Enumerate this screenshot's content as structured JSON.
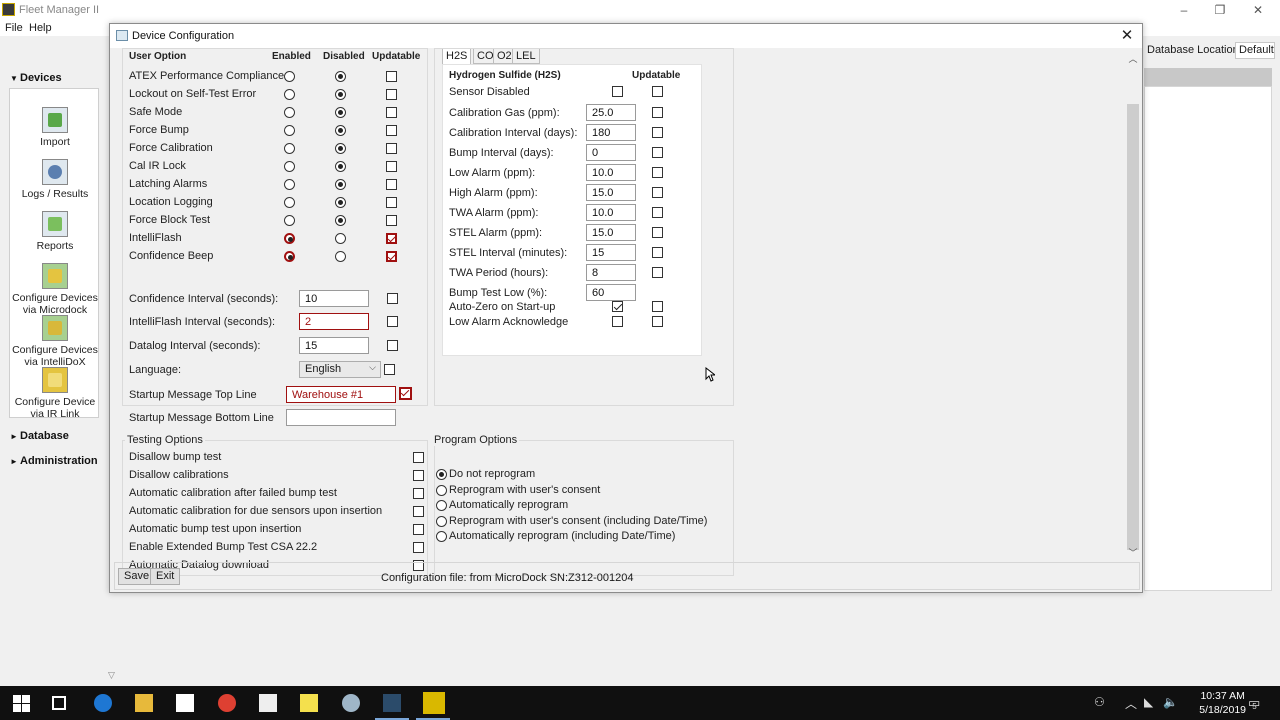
{
  "app": {
    "title": "Fleet Manager II",
    "menu": [
      "File",
      "Help"
    ],
    "sidebar": {
      "sections": [
        {
          "label": "Devices",
          "expanded": true
        },
        {
          "label": "Database",
          "expanded": false
        },
        {
          "label": "Administration",
          "expanded": false
        }
      ],
      "device_items": [
        {
          "label": "Import",
          "icon": "import-icon"
        },
        {
          "label": "Logs / Results",
          "icon": "logs-icon"
        },
        {
          "label": "Reports",
          "icon": "reports-icon"
        },
        {
          "label": "Configure Devices via Microdock",
          "icon": "microdock-icon"
        },
        {
          "label": "Configure Devices via IntelliDoX",
          "icon": "intellidox-icon"
        },
        {
          "label": "Configure Device via IR Link",
          "icon": "ir-link-icon"
        }
      ]
    },
    "database_location_label": "Database Location:",
    "database_location_value": "Default"
  },
  "dialog": {
    "title": "Device Configuration",
    "close": "✕",
    "user_options": {
      "headers": {
        "option": "User Option",
        "enabled": "Enabled",
        "disabled": "Disabled",
        "updatable": "Updatable"
      },
      "rows": [
        {
          "label": "ATEX Performance Compliance",
          "enabled": false,
          "updatable": false,
          "highlight": false
        },
        {
          "label": "Lockout on Self-Test Error",
          "enabled": false,
          "updatable": false,
          "highlight": false
        },
        {
          "label": "Safe Mode",
          "enabled": false,
          "updatable": false,
          "highlight": false
        },
        {
          "label": "Force Bump",
          "enabled": false,
          "updatable": false,
          "highlight": false
        },
        {
          "label": "Force Calibration",
          "enabled": false,
          "updatable": false,
          "highlight": false
        },
        {
          "label": "Cal IR Lock",
          "enabled": false,
          "updatable": false,
          "highlight": false
        },
        {
          "label": "Latching Alarms",
          "enabled": false,
          "updatable": false,
          "highlight": false
        },
        {
          "label": "Location Logging",
          "enabled": false,
          "updatable": false,
          "highlight": false
        },
        {
          "label": "Force Block Test",
          "enabled": false,
          "updatable": false,
          "highlight": false
        },
        {
          "label": "IntelliFlash",
          "enabled": true,
          "updatable": true,
          "highlight": true
        },
        {
          "label": "Confidence Beep",
          "enabled": true,
          "updatable": true,
          "highlight": true
        }
      ],
      "fields": [
        {
          "label": "Confidence Interval (seconds):",
          "value": "10",
          "red": false,
          "updatable": false
        },
        {
          "label": "IntelliFlash Interval (seconds):",
          "value": "2",
          "red": true,
          "updatable": false
        },
        {
          "label": "Datalog Interval (seconds):",
          "value": "15",
          "red": false,
          "updatable": false
        }
      ],
      "language_label": "Language:",
      "language_value": "English",
      "startup_top_label": "Startup Message Top Line",
      "startup_top_value": "Warehouse #1",
      "startup_bottom_label": "Startup Message Bottom Line",
      "startup_bottom_value": ""
    },
    "gas_tabs": [
      "H2S",
      "CO",
      "O2",
      "LEL"
    ],
    "gas": {
      "title": "Hydrogen Sulfide (H2S)",
      "updatable_header": "Updatable",
      "sensor_disabled": "Sensor Disabled",
      "fields": [
        {
          "label": "Calibration Gas (ppm):",
          "value": "25.0"
        },
        {
          "label": "Calibration Interval (days):",
          "value": "180"
        },
        {
          "label": "Bump Interval (days):",
          "value": "0"
        },
        {
          "label": "Low Alarm (ppm):",
          "value": "10.0"
        },
        {
          "label": "High Alarm (ppm):",
          "value": "15.0"
        },
        {
          "label": "TWA Alarm (ppm):",
          "value": "10.0"
        },
        {
          "label": "STEL Alarm (ppm):",
          "value": "15.0"
        },
        {
          "label": "STEL Interval (minutes):",
          "value": "15"
        },
        {
          "label": "TWA Period (hours):",
          "value": "8"
        },
        {
          "label": "Bump Test Low (%):",
          "value": "60"
        }
      ],
      "auto_zero": "Auto-Zero on Start-up",
      "low_alarm_ack": "Low Alarm Acknowledge"
    },
    "testing_options": {
      "title": "Testing Options",
      "items": [
        "Disallow bump test",
        "Disallow calibrations",
        "Automatic calibration after failed bump test",
        "Automatic calibration for due sensors upon insertion",
        "Automatic bump test upon insertion",
        "Enable Extended Bump Test CSA 22.2",
        "Automatic Datalog download"
      ]
    },
    "program_options": {
      "title": "Program Options",
      "items": [
        {
          "label": "Do not reprogram",
          "selected": true
        },
        {
          "label": "Reprogram with user's consent",
          "selected": false
        },
        {
          "label": "Automatically reprogram",
          "selected": false
        },
        {
          "label": "Reprogram with user's consent (including Date/Time)",
          "selected": false
        },
        {
          "label": "Automatically reprogram (including Date/Time)",
          "selected": false
        }
      ]
    },
    "buttons": {
      "save": "Save",
      "exit": "Exit"
    },
    "status": "Configuration file: from MicroDock SN:Z312-001204"
  },
  "taskbar": {
    "time": "10:37 AM",
    "date": "5/18/2019",
    "notification_count": "5"
  },
  "colors": {
    "highlight": "#a01010",
    "taskbar": "#101010"
  }
}
